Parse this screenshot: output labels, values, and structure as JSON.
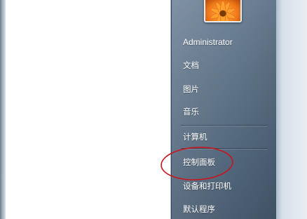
{
  "start_menu": {
    "user_name": "Administrator",
    "items": [
      {
        "label": "文档"
      },
      {
        "label": "图片"
      },
      {
        "label": "音乐"
      },
      {
        "label": "计算机"
      },
      {
        "label": "控制面板"
      },
      {
        "label": "设备和打印机"
      },
      {
        "label": "默认程序"
      }
    ]
  },
  "annotation": {
    "color": "#c8161d"
  },
  "theme": {
    "pane_color": "#5d7286",
    "text_color": "#ffffff"
  }
}
